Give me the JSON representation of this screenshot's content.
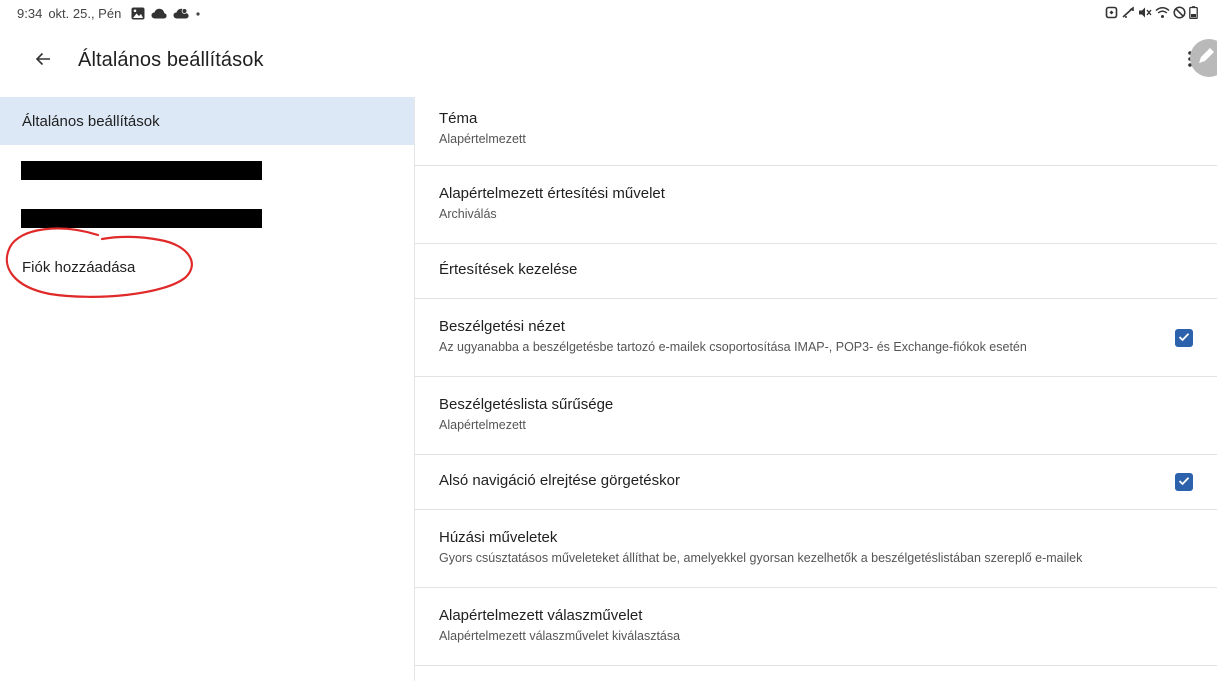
{
  "status_bar": {
    "time": "9:34",
    "date": "okt. 25., Pén",
    "left_icons": [
      "image-icon",
      "cloud-icon",
      "cloud-sync-icon",
      "dot-icon"
    ],
    "right_icons": [
      "nfc-icon",
      "bluetooth-icon",
      "mute-icon",
      "wifi-icon",
      "dnd-icon",
      "battery-icon"
    ]
  },
  "header": {
    "title": "Általános beállítások",
    "back_icon": "arrow-left-icon",
    "menu_icon": "more-vert-icon",
    "fab_icon": "edit-icon"
  },
  "sidebar": {
    "items": [
      {
        "label": "Általános beállítások",
        "selected": true
      },
      {
        "label": "",
        "redacted": true
      },
      {
        "label": "",
        "redacted": true
      },
      {
        "label": "Fiók hozzáadása",
        "annotated": true
      }
    ],
    "annotation_color": "#e02a2a",
    "selected_bg": "#dce8f6"
  },
  "settings": [
    {
      "title": "Téma",
      "summary": "Alapértelmezett"
    },
    {
      "title": "Alapértelmezett értesítési művelet",
      "summary": "Archiválás"
    },
    {
      "title": "Értesítések kezelése"
    },
    {
      "title": "Beszélgetési nézet",
      "summary": "Az ugyanabba a beszélgetésbe tartozó e-mailek csoportosítása IMAP-, POP3- és Exchange-fiókok esetén",
      "checked": true
    },
    {
      "title": "Beszélgetéslista sűrűsége",
      "summary": "Alapértelmezett"
    },
    {
      "title": "Alsó navigáció elrejtése görgetéskor",
      "checked": true
    },
    {
      "title": "Húzási műveletek",
      "summary": "Gyors csúsztatásos műveleteket állíthat be, amelyekkel gyorsan kezelhetők a beszélgetéslistában szereplő e-mailek"
    },
    {
      "title": "Alapértelmezett válaszművelet",
      "summary": "Alapértelmezett válaszművelet kiválasztása"
    }
  ],
  "colors": {
    "checkbox": "#2c61ac",
    "divider": "#e2e2e2",
    "text_primary": "#1f1f1f",
    "text_secondary": "#555555"
  }
}
